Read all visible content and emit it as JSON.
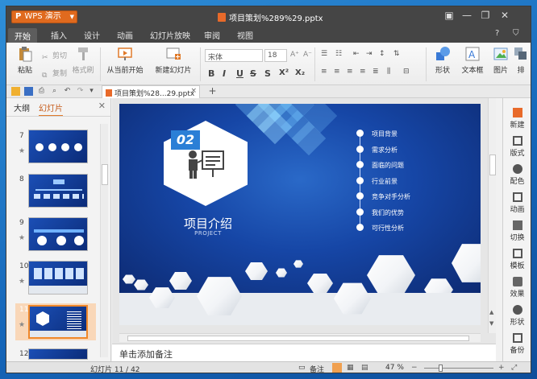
{
  "app": {
    "menu_button": "WPS 演示",
    "logo_glyph": "P",
    "document_title": "项目策划%289%29.pptx"
  },
  "menu": {
    "tabs": [
      "开始",
      "插入",
      "设计",
      "动画",
      "幻灯片放映",
      "审阅",
      "视图"
    ],
    "active_tab": "开始"
  },
  "ribbon": {
    "paste": "粘贴",
    "cut": "剪切",
    "copy": "复制",
    "format_painter": "格式刷",
    "from_current": "从当前开始",
    "new_slide": "新建幻灯片",
    "font_name": "宋体",
    "font_size": "18",
    "shape": "形状",
    "textbox": "文本框",
    "picture": "图片",
    "arrange": "排"
  },
  "doc_tab": {
    "label": "项目策划%28...29.pptx",
    "close": "×",
    "add": "+"
  },
  "left_panel": {
    "tabs": [
      "大纲",
      "幻灯片"
    ],
    "active_tab": "幻灯片",
    "slides": [
      "7",
      "8",
      "9",
      "10",
      "11",
      "12"
    ],
    "selected_slide": "11"
  },
  "slide": {
    "number_badge": "02",
    "title": "项目介绍",
    "subtitle": "PROJECT",
    "items": [
      "项目背景",
      "需求分析",
      "面临的问题",
      "行业前景",
      "竞争对手分析",
      "我们的优势",
      "可行性分析"
    ]
  },
  "notes": {
    "placeholder": "单击添加备注"
  },
  "right_panel": {
    "items": [
      "新建",
      "版式",
      "配色",
      "动画",
      "切换",
      "模板",
      "效果",
      "形状",
      "备份"
    ]
  },
  "status": {
    "slide_counter": "幻灯片 11 / 42",
    "notes_label": "备注",
    "zoom": "47 %"
  },
  "colors": {
    "accent": "#e07a2a",
    "titlebar": "#454545",
    "slide_blue": "#1646a6"
  }
}
